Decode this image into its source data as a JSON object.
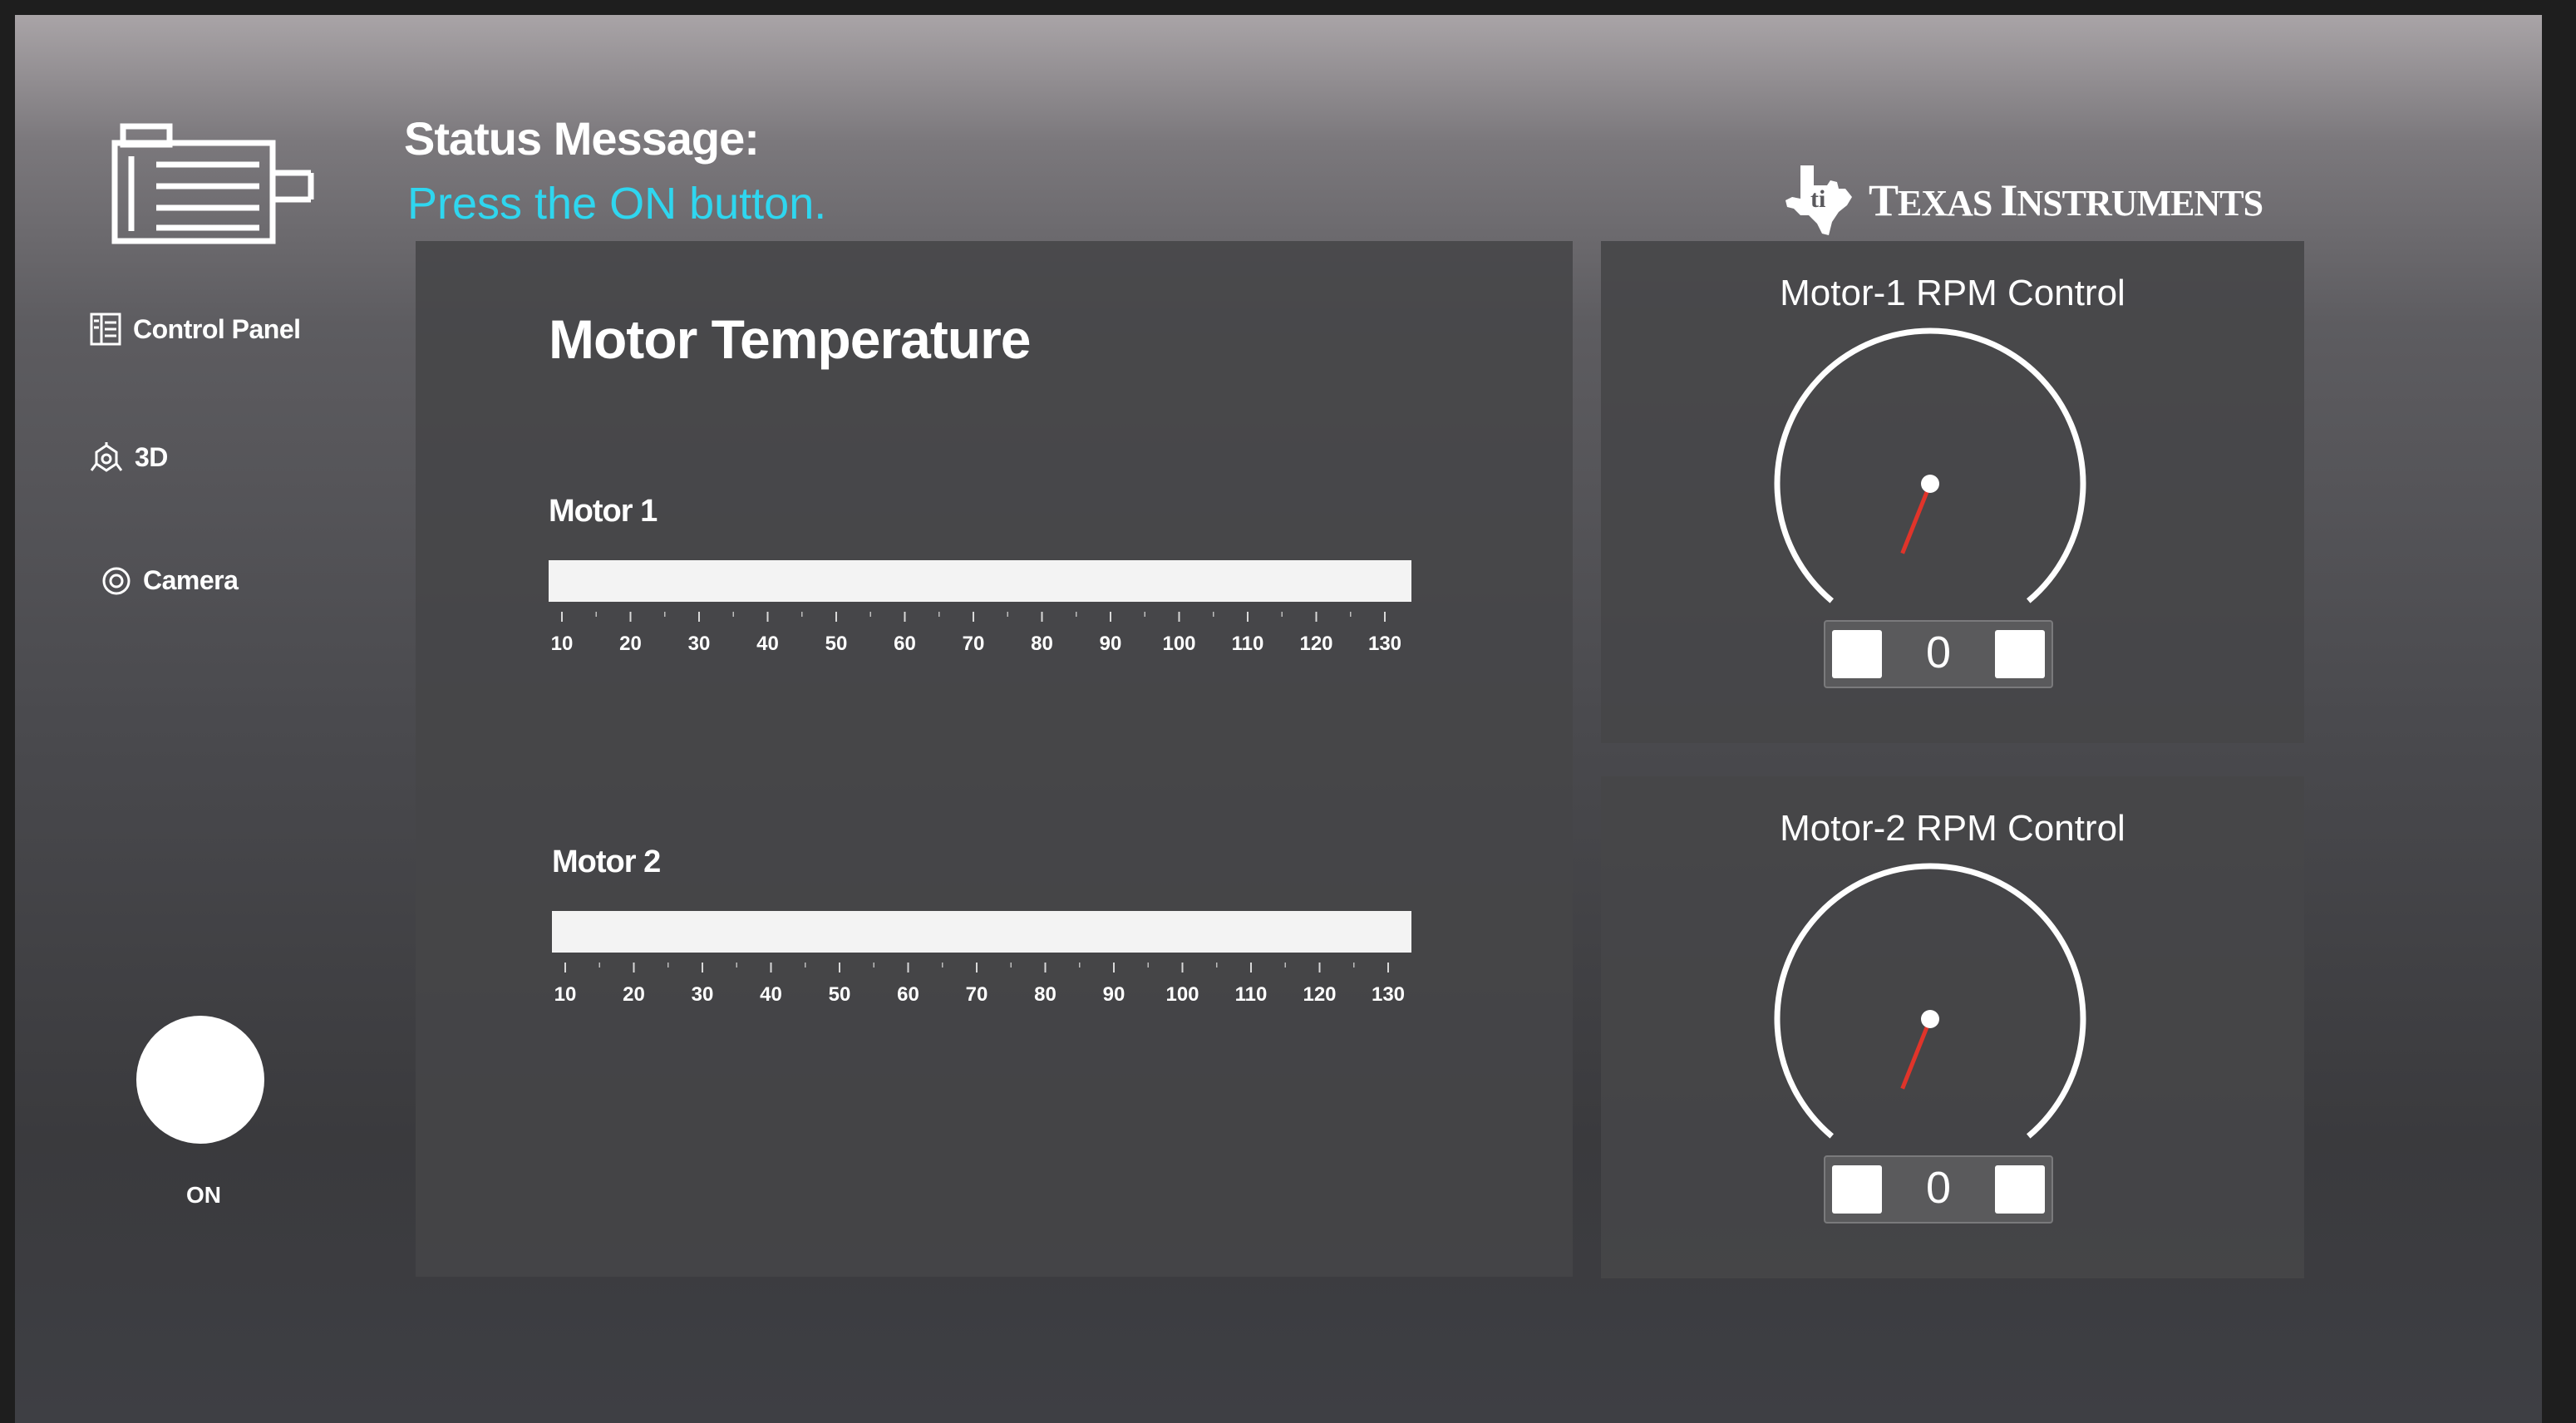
{
  "app": {
    "status_title": "Status Message:",
    "status_text": "Press the ON button."
  },
  "branding": {
    "ti_logo_text": "TEXAS INSTRUMENTS",
    "ti_first": "T",
    "ti_rest1": "EXAS ",
    "ti_second": "I",
    "ti_rest2": "NSTRUMENTS"
  },
  "sidebar": {
    "items": [
      {
        "label": "Control Panel",
        "icon": "control-panel-icon"
      },
      {
        "label": "3D",
        "icon": "cube-3d-icon"
      },
      {
        "label": "Camera",
        "icon": "camera-icon"
      }
    ],
    "on_label": "ON"
  },
  "temperature": {
    "title": "Motor Temperature",
    "scale_ticks": [
      "10",
      "20",
      "30",
      "40",
      "50",
      "60",
      "70",
      "80",
      "90",
      "100",
      "110",
      "120",
      "130"
    ],
    "motors": [
      {
        "label": "Motor 1"
      },
      {
        "label": "Motor 2"
      }
    ]
  },
  "rpm_controls": [
    {
      "title": "Motor-1 RPM Control",
      "value": "0"
    },
    {
      "title": "Motor-2 RPM Control",
      "value": "0"
    }
  ],
  "colors": {
    "status_accent": "#2fd6ef",
    "needle": "#e0342a",
    "panel": "#464648"
  }
}
